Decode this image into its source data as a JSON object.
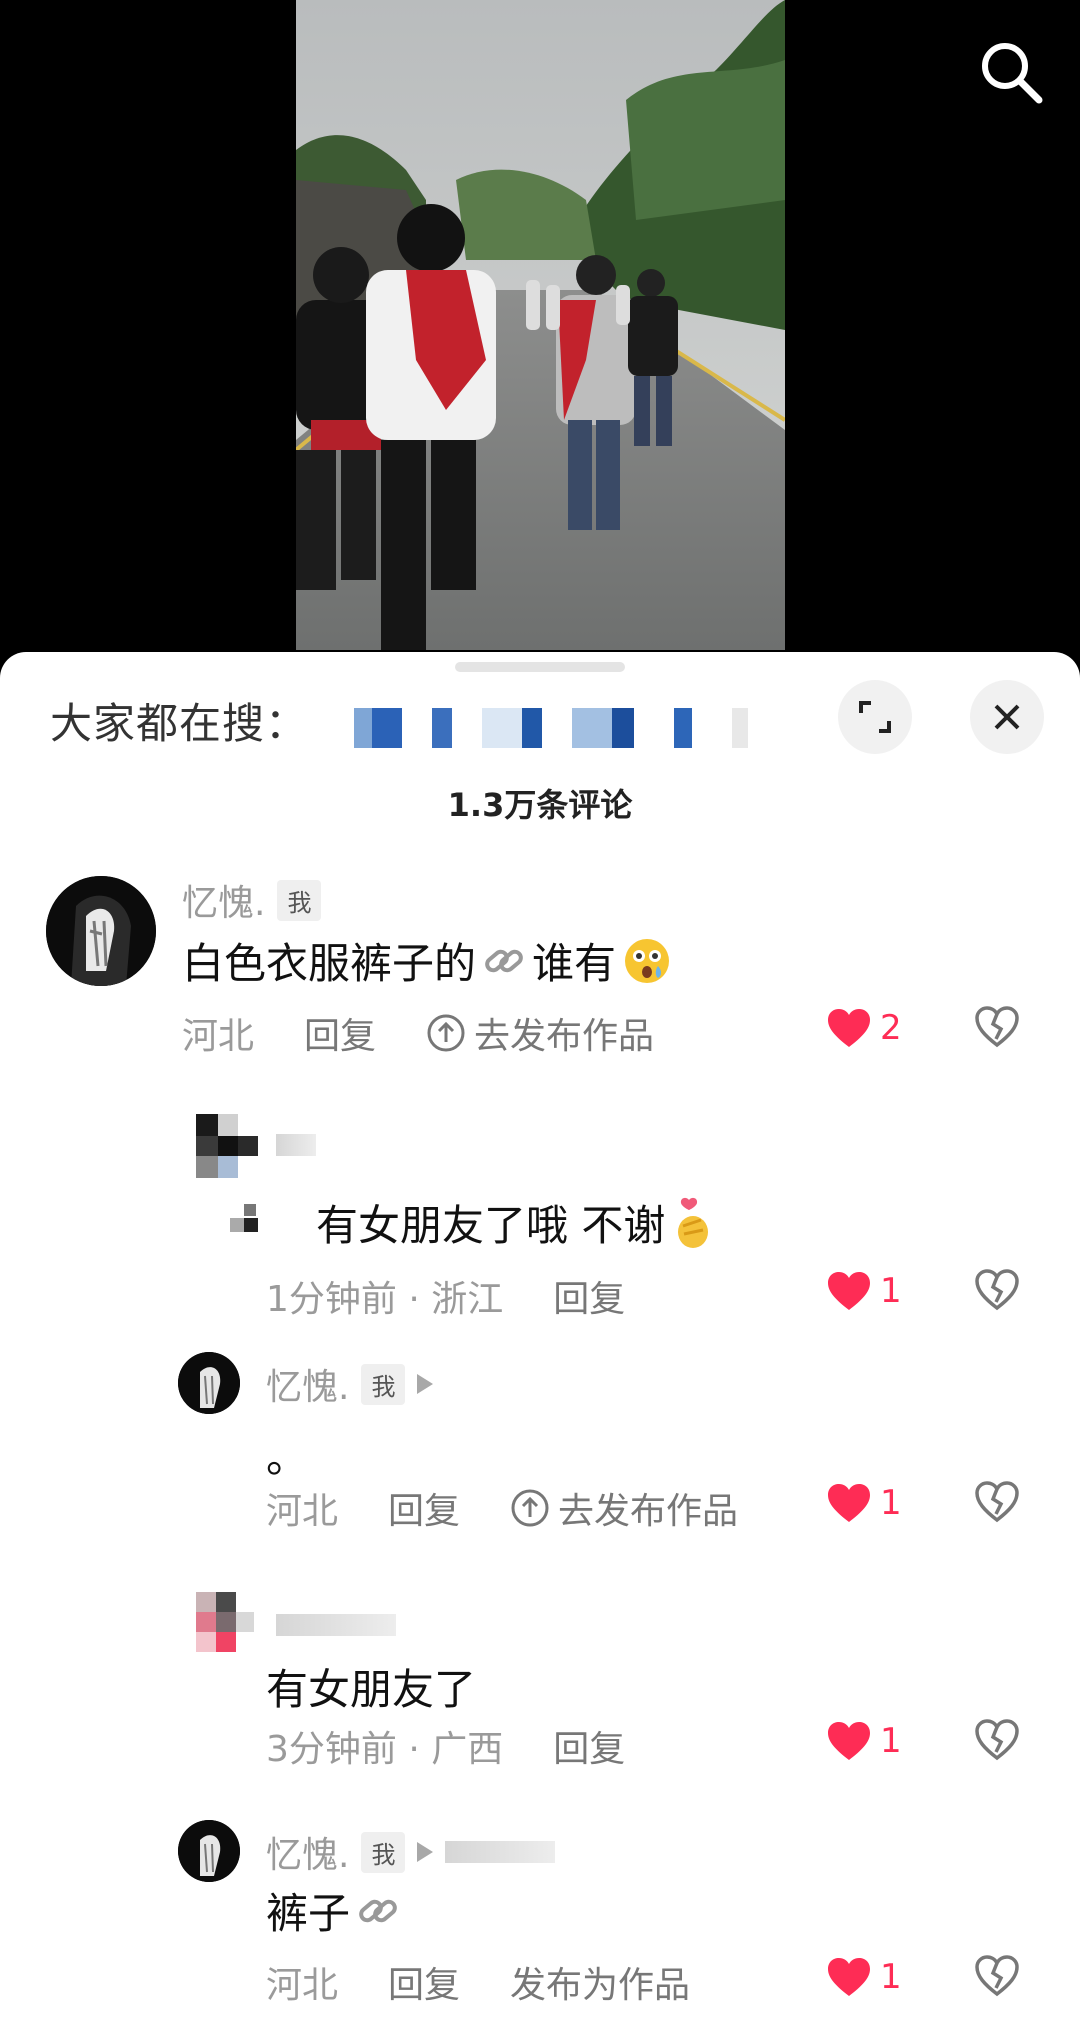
{
  "search_bar": {
    "label": "大家都在搜："
  },
  "comment_count": "1.3万条评论",
  "comments": [
    {
      "username": "忆愧.",
      "tag": "我",
      "text": "白色衣服裤子的",
      "text_suffix": "谁有",
      "location": "河北",
      "reply_label": "回复",
      "publish_label": "去发布作品",
      "likes": "2"
    },
    {
      "text": "有女朋友了哦 不谢",
      "meta": "1分钟前 · 浙江",
      "reply_label": "回复",
      "likes": "1"
    },
    {
      "username": "忆愧.",
      "tag": "我",
      "text": "。",
      "location": "河北",
      "reply_label": "回复",
      "publish_label": "去发布作品",
      "likes": "1"
    },
    {
      "text": "有女朋友了",
      "meta": "3分钟前 · 广西",
      "reply_label": "回复",
      "likes": "1"
    },
    {
      "username": "忆愧.",
      "tag": "我",
      "text": "裤子",
      "location": "河北",
      "reply_label": "回复",
      "publish_label": "发布为作品",
      "likes": "1"
    }
  ],
  "icons": {
    "search": "search-icon",
    "expand": "expand-icon",
    "close": "close-icon",
    "like": "heart-icon",
    "dislike": "broken-heart-icon",
    "link": "link-icon",
    "publish": "upload-circle-icon"
  },
  "colors": {
    "like": "#fe2c55",
    "muted": "#9a9a9a",
    "sheet": "#ffffff"
  }
}
